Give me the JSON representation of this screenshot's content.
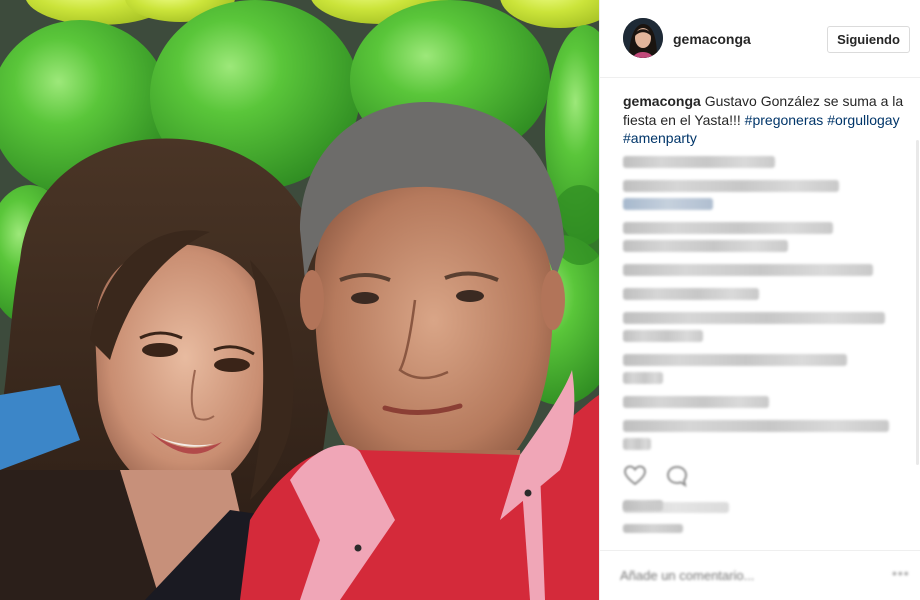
{
  "header": {
    "username": "gemaconga",
    "follow_label": "Siguiendo"
  },
  "caption": {
    "username": "gemaconga",
    "text": "Gustavo González se suma a la fiesta en el Yasta!!!",
    "hashtags": [
      "#pregoneras",
      "#orgullogay",
      "#amenparty"
    ]
  },
  "comments": {
    "blurred": true,
    "line_count": 15
  },
  "actions": {
    "like_icon": "heart-icon",
    "comment_icon": "speech-bubble-icon"
  },
  "comment_box": {
    "placeholder": "Añade un comentario..."
  },
  "colors": {
    "hashtag": "#003569",
    "text": "#262626",
    "border": "#efefef",
    "balloon_green": "#5cc43e",
    "balloon_lime": "#c9e83a",
    "shirt_red": "#d42a3a"
  }
}
